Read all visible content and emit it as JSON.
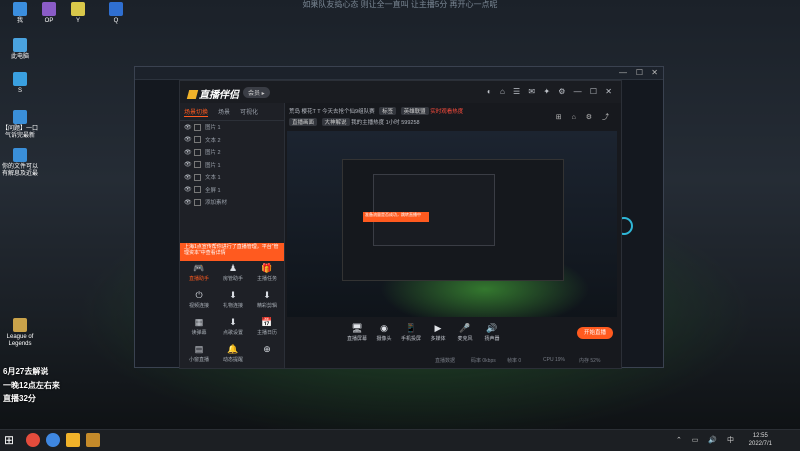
{
  "top_caption": "如果队友捣心态 则让全一直叫 让主播5分 再开心一点呢",
  "desktop_icons": [
    {
      "label": "我",
      "color": "#3b8ede"
    },
    {
      "label": "OP",
      "color": "#8a5cc7"
    },
    {
      "label": "Y",
      "color": "#d9c84a"
    },
    {
      "label": "Q",
      "color": "#2f6fd1"
    },
    {
      "label": "此电脑",
      "color": "#4aa3df"
    },
    {
      "label": "S",
      "color": "#3aa0e0"
    },
    {
      "label": "【问题】一口气诉完最新",
      "color": "#3a8fd9"
    },
    {
      "label": "你的文件可以有解息及近最",
      "color": "#3a8fd9"
    },
    {
      "label": "League of Legends",
      "color": "#c9a24a"
    }
  ],
  "overlay_text": {
    "line1": "6月27去解说",
    "line2": "一晚12点左右来",
    "line3": "直播32分"
  },
  "app": {
    "logo_text": "直播伴侣",
    "version_badge": "会员 ▸",
    "left_tabs": [
      "场景切换",
      "场景",
      "可视化"
    ],
    "layers": [
      {
        "eye": "👁",
        "name": "图片 1"
      },
      {
        "eye": "👁",
        "name": "文本 2"
      },
      {
        "eye": "👁",
        "name": "图片 2"
      },
      {
        "eye": "👁",
        "name": "图片 1"
      },
      {
        "eye": "👁",
        "name": "文本 1"
      },
      {
        "eye": "👁",
        "name": "全屏 1"
      },
      {
        "eye": "👁",
        "name": "添加素材"
      }
    ],
    "banner_text": "上海1点宣传帮你进行了直播管理，平台“管理资本”中查看详情",
    "tools": [
      {
        "icon": "🎮",
        "label": "直播助手",
        "active": true
      },
      {
        "icon": "♟",
        "label": "房管助手",
        "active": false
      },
      {
        "icon": "🎁",
        "label": "主播任务",
        "active": false
      },
      {
        "icon": "⏻",
        "label": "视频连接",
        "active": false
      },
      {
        "icon": "⬇",
        "label": "礼物连接",
        "active": false
      },
      {
        "icon": "⬇",
        "label": "精彩剪辑",
        "active": false
      },
      {
        "icon": "▦",
        "label": "读弹幕",
        "active": false
      },
      {
        "icon": "⬇",
        "label": "点歌设置",
        "active": false
      },
      {
        "icon": "📅",
        "label": "主播日历",
        "active": false
      },
      {
        "icon": "▤",
        "label": "小窗直播",
        "active": false
      },
      {
        "icon": "🔔",
        "label": "动态提醒",
        "active": false
      },
      {
        "icon": "⊕",
        "label": "",
        "active": false
      }
    ],
    "header_line1_title": "荒岛 樱花T T 今天去抢个仙9组队赛",
    "header_line1_pill1": "标签",
    "header_line1_pill2": "英雄联盟",
    "header_line1_red": "实时观看热度",
    "header_line2_label": "直播画面",
    "header_line2_pill": "大神解说",
    "header_line2_text": "我的主播热度 1小时 599258",
    "controls": [
      {
        "icon": "🖥",
        "label": "直播屏幕"
      },
      {
        "icon": "◉",
        "label": "摄像头"
      },
      {
        "icon": "📱",
        "label": "手机投屏"
      },
      {
        "icon": "▶",
        "label": "多媒体"
      },
      {
        "icon": "🎤",
        "label": "麦克风"
      },
      {
        "icon": "🔊",
        "label": "扬声器"
      }
    ],
    "go_live_label": "开始直播",
    "status_items": [
      "直播数据",
      "码率 0kbps",
      "帧率 0",
      "CPU 19%",
      "内存 52%"
    ],
    "preview_nested_text": "准备流量是否成功，跳转直播中"
  },
  "taskbar": {
    "time": "12:55",
    "date": "2022/7/1",
    "icons": [
      {
        "name": "start-icon",
        "color": "#ffffff"
      },
      {
        "name": "chrome-icon",
        "color": "#e44c3c"
      },
      {
        "name": "chrome2-icon",
        "color": "#3f87e0"
      },
      {
        "name": "streamer-app-icon",
        "color": "#f0b22a"
      },
      {
        "name": "broadcast-app-icon",
        "color": "#c48a2a"
      }
    ]
  }
}
